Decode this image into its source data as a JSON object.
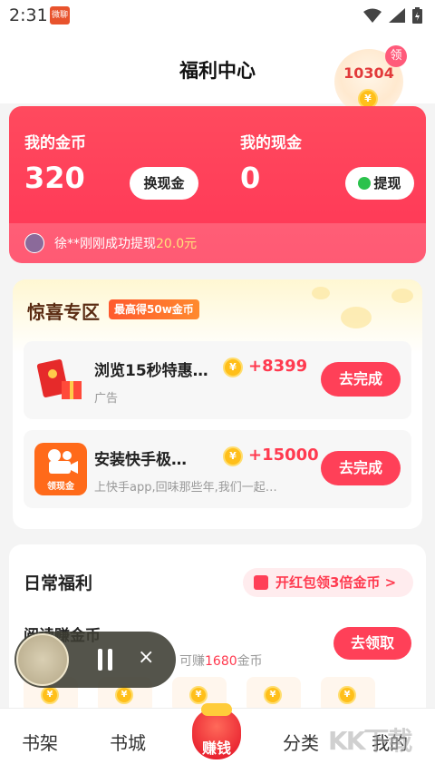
{
  "status_bar": {
    "time": "2:31",
    "app_badge": "微聊"
  },
  "header": {
    "title": "福利中心"
  },
  "coin_bubble": {
    "count": "10304",
    "badge": "领",
    "coin_glyph": "¥"
  },
  "wallet": {
    "coins_label": "我的金币",
    "coins_value": "320",
    "exchange_button": "换现金",
    "cash_label": "我的现金",
    "cash_value": "0",
    "withdraw_button": "提现",
    "notice_text": "徐**刚刚成功提现",
    "notice_amount": "20.0元"
  },
  "surprise": {
    "title": "惊喜专区",
    "tag": "最高得50w金币",
    "tasks": [
      {
        "name": "浏览15秒特惠…",
        "sub": "广告",
        "reward": "+8399",
        "button": "去完成",
        "icon": "red-envelope-gift-icon"
      },
      {
        "name": "安装快手极…",
        "sub": "上快手app,回味那些年,我们一起…",
        "reward": "+15000",
        "button": "去完成",
        "icon": "kuaishou-app-icon",
        "icon_label": "领现金"
      }
    ]
  },
  "daily": {
    "title": "日常福利",
    "promo": "开红包领3倍金币 >",
    "read_title": "阅读赚金币",
    "read_sub_prefix": "可赚",
    "read_sub_amount": "1680",
    "read_sub_suffix": "金币",
    "claim_button": "去领取"
  },
  "player": {
    "close": "×"
  },
  "tabbar": {
    "bookshelf": "书架",
    "bookstore": "书城",
    "earn": "赚钱",
    "category": "分类",
    "mine": "我的"
  },
  "watermark": "KK下载",
  "colors": {
    "accent": "#ff4058",
    "coin": "#ffbf1a",
    "title_brown": "#5a2b12"
  }
}
